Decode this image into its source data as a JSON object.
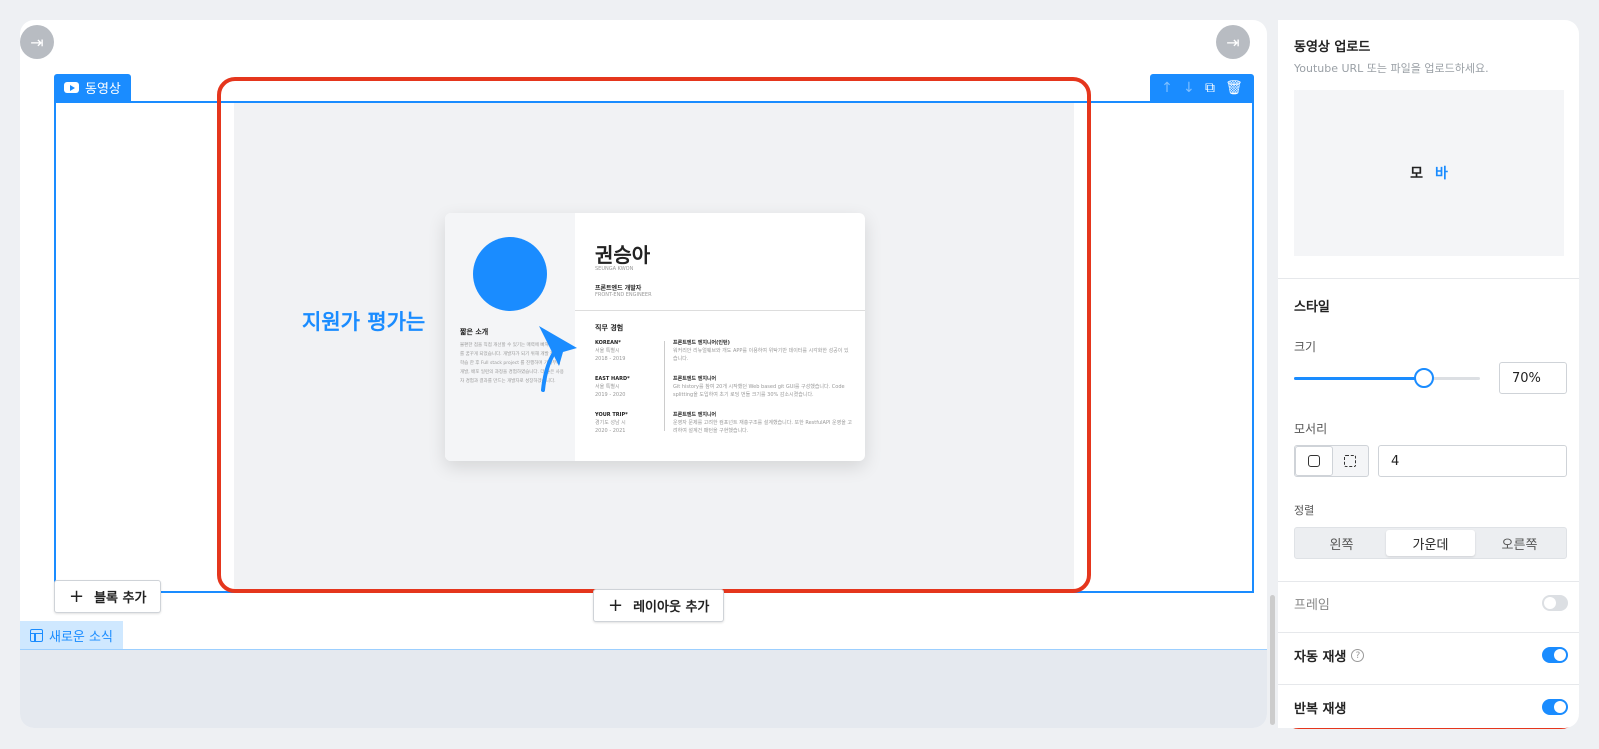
{
  "editor": {
    "block_label": "동영상",
    "block_tools": {
      "up": "↑",
      "down": "↓",
      "copy": "⧉",
      "delete": "🗑"
    },
    "add_block_label": "블록 추가",
    "add_layout_label": "레이아웃 추가",
    "section_label": "새로운 소식",
    "collapse_icon": "⇥"
  },
  "video": {
    "overlay_text": "지원가 평가는",
    "resume": {
      "name": "권승아",
      "name_en": "SEUNGA KWON",
      "role": "프론트엔드 개발자",
      "role_en": "FRONT-END ENGINEER",
      "intro_title": "짧은 소개",
      "intro_body": "불편한 점을 직접 개선할 수 있기는 매력에 빠져 개발자를 꿈꾸게 되었습니다. 개발자가 되기 위해 개발 전반을 학습 한 후 Full stack project 를 진행하며 기획부터 개발, 배포 일련의 과정을 경험하였습니다. 더 좋은 사용자 경험과 결과를 만드는 개발자로 성장하겠습니다.",
      "experience_title": "직무 경험",
      "experience": [
        {
          "company": "KOREAN*",
          "place": "서울 특별시",
          "period": "2018 - 2019",
          "title": "프론트엔드 엔지니어(인턴)",
          "desc": "워커리안 리뉴얼웨브와 개도 APP를 이용하여 위탁기반 데이터를 시각화한 성공이 있습니다."
        },
        {
          "company": "EAST HARD*",
          "place": "서울 특별시",
          "period": "2019 - 2020",
          "title": "프론트엔드 엔지니어",
          "desc": "Git history를 참여 20개 시작했던 Web based git GUI를 구성했습니다. Code splitting을 도입하여 초기 로딩 번들 크기를 30% 감소시켰습니다."
        },
        {
          "company": "YOUR TRIP*",
          "place": "경기도 성남 시",
          "period": "2020 - 2021",
          "title": "프론트엔드 엔지니어",
          "desc": "운영자 문제를 고려한 컴포넌트 재충구조를 설계했습니다. 또한 RestfulAPI 운영을 고려하여 설계건 패턴을 구현했습니다."
        }
      ]
    }
  },
  "panel": {
    "video_upload_title": "동영상 업로드",
    "video_upload_desc": "Youtube URL 또는 파일을 업로드하세요.",
    "preview_text_1": "모",
    "preview_text_2": "바",
    "style_title": "스타일",
    "size_label": "크기",
    "size_value": "70%",
    "size_percent": 70,
    "corner_label": "모서리",
    "corner_value": "4",
    "align_label": "정렬",
    "align_options": [
      "왼쪽",
      "가운데",
      "오른쪽"
    ],
    "align_selected": "가운데",
    "frame_label": "프레임",
    "frame_on": false,
    "autoplay_label": "자동 재생",
    "autoplay_on": true,
    "loop_label": "반복 재생",
    "loop_on": true,
    "help_icon": "?"
  },
  "colors": {
    "accent": "#1a8cff",
    "highlight": "#e5361d"
  }
}
